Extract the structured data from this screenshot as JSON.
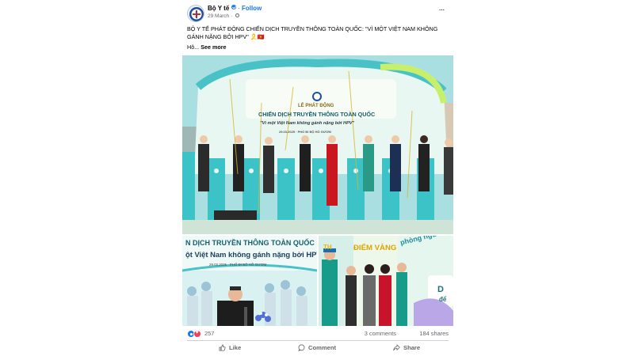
{
  "post": {
    "page_name": "Bộ Y tế",
    "separator": "·",
    "follow_label": "Follow",
    "date": "29 March",
    "text": "BỘ Y TẾ PHÁT ĐỘNG CHIẾN DỊCH TRUYỀN THÔNG TOÀN QUỐC: \"VÌ MỘT VIỆT NAM KHÔNG GÁNH NẶNG BỞI HPV\" 🎗️🇻🇳",
    "truncated_text": "Hô...",
    "see_more_label": "See more",
    "more_icon": "···"
  },
  "photos": {
    "main": {
      "event_label": "LỄ PHÁT ĐỘNG",
      "campaign": "CHIẾN DỊCH TRUYỀN THÔNG TOÀN QUỐC",
      "slogan": "\"Vì một Việt Nam không gánh nặng bởi HPV\"",
      "date_line": "29.03.2025 · PHỐ ĐI BỘ HỒ GƯƠM"
    },
    "left": {
      "campaign": "N DỊCH TRUYỀN THÔNG TOÀN QUỐC",
      "slogan": "ột Việt Nam không gánh nặng bởi HPV\"",
      "date_line": "29.03.2025 · PHỐ ĐI BỘ HỒ GƯƠM"
    },
    "right": {
      "text_1": "TH",
      "text_2": "ĐIỂM VÀNG",
      "text_3": "phòng ngừa HIỆU QUẢ NHẤT",
      "text_4": "D",
      "text_5": "để"
    }
  },
  "reactions": {
    "count": "257",
    "comments": "3 comments",
    "shares": "184 shares"
  },
  "actions": {
    "like": "Like",
    "comment": "Comment",
    "share": "Share"
  },
  "colors": {
    "accent": "#1877f2",
    "secondary_text": "#65676b",
    "love": "#f33e58"
  }
}
